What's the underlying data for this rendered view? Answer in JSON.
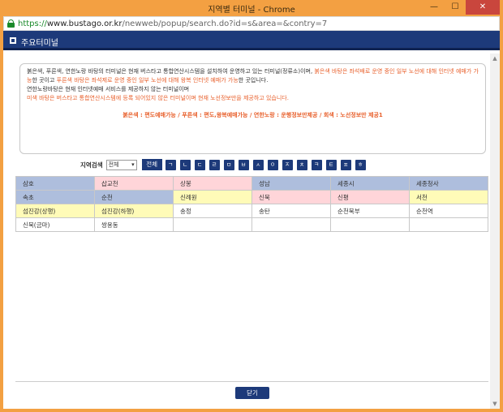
{
  "window": {
    "title": "지역별 터미널 - Chrome",
    "minimize": "—",
    "maximize": "☐",
    "close": "✕"
  },
  "address_bar": {
    "scheme": "https://",
    "host": "www.bustago.or.kr",
    "path": "/newweb/popup/search.do?id=s&area=&contry=7"
  },
  "header": {
    "title": "주요터미널"
  },
  "notice": {
    "line1_a": "붉은색, 푸른색, 연한노랑 바탕의 터미널은 현재 버스타고 통합연산시스템을 설치하여 운영하고 있는 터미널(정류소)이며, ",
    "line1_b": "붉은색 바탕은 좌석배로 운영 중인 일부 노선에 대해 인터넷 예매가 가능",
    "line1_c": "한 곳이고 ",
    "line1_d": "푸른색 바탕은 좌석제로 운영 중인 일부 노선에 대해 왕복 인터넷 예매가 가능",
    "line1_e": "한 곳입니다.",
    "line2": "연한노랑바탕은 현재 인터넷예매 서비스를 제공하지 않는 터미널이며",
    "line3": "미색 바탕은 버스타고 통합연산시스템에 등록 되어있지 않은 터미널이며 현재 노선정보만을 제공하고 있습니다.",
    "legend": "붉은색 : 편도예매가능 / 푸른색 : 편도,왕복예매가능 / 연한노랑 : 운행정보만제공 / 회색 : 노선정보만 제공1"
  },
  "search": {
    "label": "지역검색",
    "selected": "전체",
    "all_button": "전체",
    "consonants": [
      "ㄱ",
      "ㄴ",
      "ㄷ",
      "ㄹ",
      "ㅁ",
      "ㅂ",
      "ㅅ",
      "ㅇ",
      "ㅈ",
      "ㅊ",
      "ㅋ",
      "ㅌ",
      "ㅍ",
      "ㅎ"
    ]
  },
  "terminals": [
    [
      {
        "name": "삼호",
        "color": "blue"
      },
      {
        "name": "삽교천",
        "color": "pink"
      },
      {
        "name": "상봉",
        "color": "pink"
      },
      {
        "name": "성남",
        "color": "blue"
      },
      {
        "name": "세종시",
        "color": "blue"
      },
      {
        "name": "세종청사",
        "color": "blue"
      }
    ],
    [
      {
        "name": "속초",
        "color": "blue"
      },
      {
        "name": "순천",
        "color": "blue"
      },
      {
        "name": "신례원",
        "color": "yellow"
      },
      {
        "name": "신북",
        "color": "pink"
      },
      {
        "name": "신평",
        "color": "pink"
      },
      {
        "name": "서천",
        "color": "yellow"
      }
    ],
    [
      {
        "name": "섬진강(상행)",
        "color": "yellow"
      },
      {
        "name": "섬진강(하행)",
        "color": "yellow"
      },
      {
        "name": "송정",
        "color": "white"
      },
      {
        "name": "송탄",
        "color": "white"
      },
      {
        "name": "순천북부",
        "color": "white"
      },
      {
        "name": "순천역",
        "color": "white"
      }
    ],
    [
      {
        "name": "신북(금마)",
        "color": "white"
      },
      {
        "name": "쌍용동",
        "color": "white"
      },
      {
        "name": "",
        "color": "white"
      },
      {
        "name": "",
        "color": "white"
      },
      {
        "name": "",
        "color": "white"
      },
      {
        "name": "",
        "color": "white"
      }
    ]
  ],
  "footer": {
    "close_button": "닫기"
  },
  "colors": {
    "header_navy": "#1d3a7a",
    "titlebar_orange": "#f3a042",
    "notice_red": "#e8602c",
    "cell_blue": "#aebedd",
    "cell_pink": "#ffd5d9",
    "cell_yellow": "#fffbb8"
  }
}
